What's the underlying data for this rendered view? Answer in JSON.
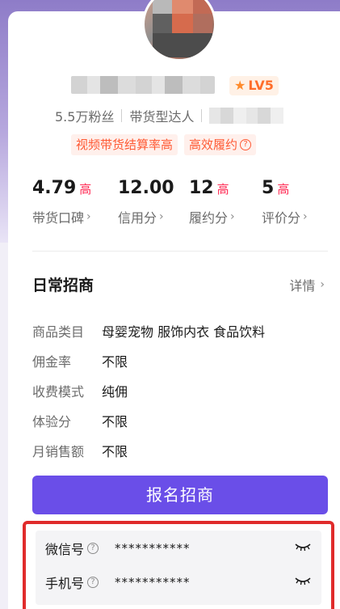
{
  "profile": {
    "level_badge": "LV5",
    "followers": "5.5万粉丝",
    "category": "带货型达人",
    "tags": [
      "视频带货结算率高",
      "高效履约"
    ]
  },
  "stats": [
    {
      "value": "4.79",
      "level": "高",
      "label": "带货口碑"
    },
    {
      "value": "12.00",
      "level": "",
      "label": "信用分"
    },
    {
      "value": "12",
      "level": "高",
      "label": "履约分"
    },
    {
      "value": "5",
      "level": "高",
      "label": "评价分"
    }
  ],
  "section": {
    "title": "日常招商",
    "details_label": "详情"
  },
  "info": [
    {
      "key": "商品类目",
      "value": "母婴宠物 服饰内衣 食品饮料"
    },
    {
      "key": "佣金率",
      "value": "不限"
    },
    {
      "key": "收费模式",
      "value": "纯佣"
    },
    {
      "key": "体验分",
      "value": "不限"
    },
    {
      "key": "月销售额",
      "value": "不限"
    }
  ],
  "signup_button": "报名招商",
  "contacts": [
    {
      "label": "微信号",
      "value": "***********"
    },
    {
      "label": "手机号",
      "value": "***********"
    }
  ],
  "icons": {
    "level_star": "star-icon",
    "question": "help-icon",
    "chevron": "chevron-right-icon",
    "eye_closed": "eye-closed-icon"
  },
  "colors": {
    "accent": "#6a4ee8",
    "highlight_red": "#ff2c55",
    "tag_orange": "#ff5a35",
    "annotation_red": "#e02b2b"
  }
}
